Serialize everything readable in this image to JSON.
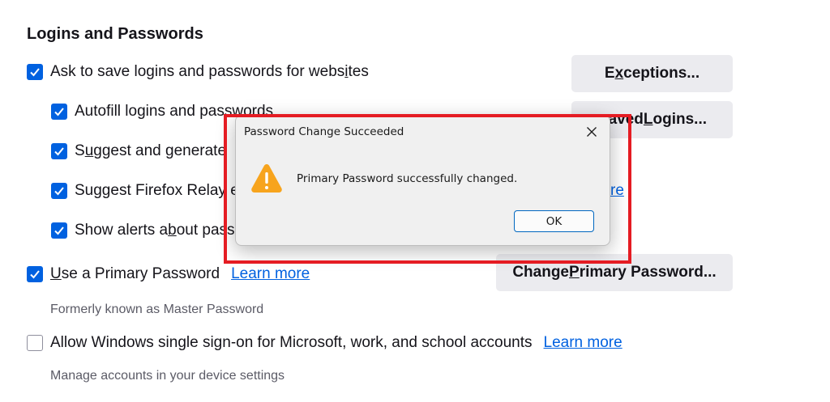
{
  "section": {
    "heading": "Logins and Passwords"
  },
  "options": {
    "ask_save": {
      "pre": "Ask to save logins and passwords for webs",
      "mid": "i",
      "post": "tes",
      "checked": true
    },
    "autofill": {
      "pre": "Autofill logins and passwords",
      "checked": true
    },
    "suggest_generate": {
      "pre": "S",
      "mid": "u",
      "post": "ggest and generate",
      "checked": true
    },
    "suggest_relay": {
      "text": "Suggest Firefox Relay e",
      "checked": true
    },
    "show_alerts": {
      "pre": "Show alerts a",
      "mid": "b",
      "post": "out pass",
      "checked": true
    },
    "primary_password": {
      "pre": "",
      "mid": "U",
      "post": "se a Primary Password",
      "link": "Learn more",
      "checked": true,
      "note": "Formerly known as Master Password"
    },
    "windows_sso": {
      "text": "Allow Windows single sign-on for Microsoft, work, and school accounts",
      "link": "Learn more",
      "checked": false,
      "note": "Manage accounts in your device settings"
    }
  },
  "buttons": {
    "exceptions": {
      "pre": "E",
      "mid": "x",
      "post": "ceptions..."
    },
    "saved_logins": {
      "pre": "aved ",
      "mid": "L",
      "post": "ogins..."
    },
    "change_primary": {
      "pre": "Change ",
      "mid": "P",
      "post": "rimary Password..."
    },
    "relay_link_fragment": "re"
  },
  "dialog": {
    "title": "Password Change Succeeded",
    "close_glyph": "✕",
    "message": "Primary Password successfully changed.",
    "ok_label": "OK",
    "icon": "warning-triangle-icon"
  },
  "colors": {
    "accent": "#0061e0",
    "highlight": "#e51c23",
    "warning": "#f7a41d"
  }
}
